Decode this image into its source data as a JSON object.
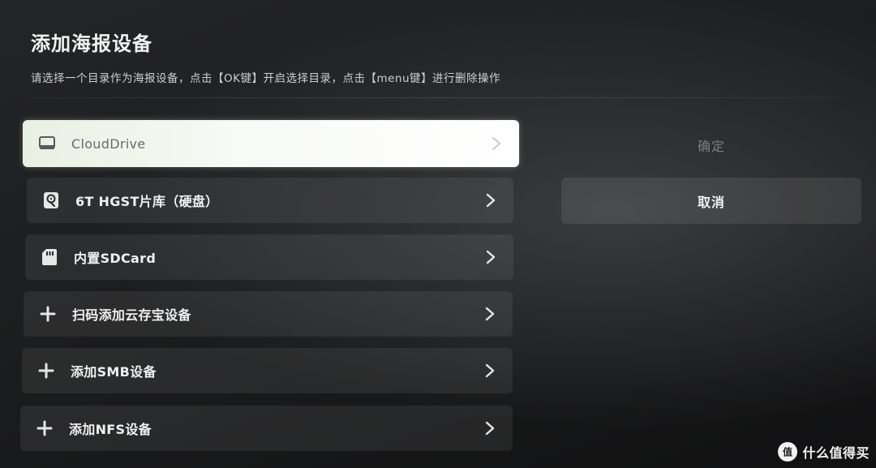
{
  "header": {
    "title": "添加海报设备",
    "subtitle": "请选择一个目录作为海报设备，点击【OK键】开启选择目录，点击【menu键】进行删除操作"
  },
  "device_list": [
    {
      "label": "CloudDrive",
      "icon": "drive-icon",
      "focused": true
    },
    {
      "label": "6T HGST片库（硬盘）",
      "icon": "hard-disk-icon",
      "focused": false
    },
    {
      "label": "内置SDCard",
      "icon": "sd-card-icon",
      "focused": false
    },
    {
      "label": "扫码添加云存宝设备",
      "icon": "plus-icon",
      "focused": false
    },
    {
      "label": "添加SMB设备",
      "icon": "plus-icon",
      "focused": false
    },
    {
      "label": "添加NFS设备",
      "icon": "plus-icon",
      "focused": false
    }
  ],
  "actions": {
    "confirm_label": "确定",
    "cancel_label": "取消"
  },
  "watermark": {
    "text": "什么值得买"
  },
  "colors": {
    "focused_item": "#f8faf6",
    "item_background": "#2b2c2e",
    "disabled_text": "#7d7e80",
    "text": "#f0f0f0"
  }
}
